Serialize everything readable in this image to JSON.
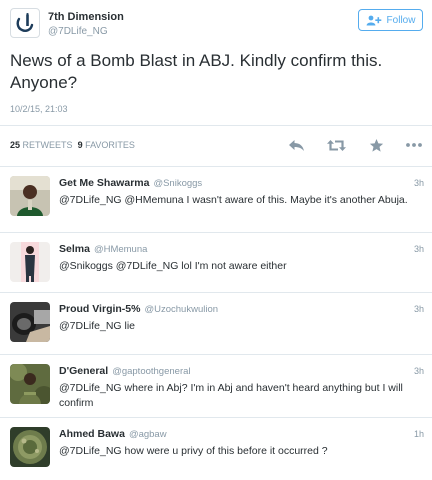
{
  "tweet": {
    "author": {
      "name": "7th Dimension",
      "handle": "@7DLife_NG",
      "avatar_icon": "7th-dimension-logo-icon"
    },
    "follow_label": "Follow",
    "follow_icon": "add-user-icon",
    "text": "News of a Bomb Blast in ABJ. Kindly confirm this. Anyone?",
    "timestamp": "10/2/15, 21:03",
    "stats": {
      "retweets_count": "25",
      "retweets_label": "RETWEETS",
      "favorites_count": "9",
      "favorites_label": "FAVORITES"
    },
    "actions": [
      "reply-icon",
      "retweet-icon",
      "favorite-star-icon",
      "more-dots-icon"
    ]
  },
  "colors": {
    "accent": "#55acee",
    "muted": "#8899a6",
    "text": "#292f33",
    "action_icon": "#8899a6",
    "divider": "#e1e8ed"
  },
  "replies": [
    {
      "name": "Get Me Shawarma",
      "handle": "@Snikoggs",
      "time": "3h",
      "text": "@7DLife_NG @HMemuna I wasn't aware of this. Maybe it's another Abuja."
    },
    {
      "name": "Selma",
      "handle": "@HMemuna",
      "time": "3h",
      "text": "@Snikoggs @7DLife_NG lol I'm not aware either"
    },
    {
      "name": "Proud Virgin-5%",
      "handle": "@Uzochukwulion",
      "time": "3h",
      "text": "@7DLife_NG lie"
    },
    {
      "name": "D'General",
      "handle": "@gaptoothgeneral",
      "time": "3h",
      "text": "@7DLife_NG where in Abj? I'm in Abj and haven't heard anything but I will confirm"
    },
    {
      "name": "Ahmed Bawa",
      "handle": "@agbaw",
      "time": "1h",
      "text": "@7DLife_NG how were u privy of this before it occurred ?"
    }
  ]
}
